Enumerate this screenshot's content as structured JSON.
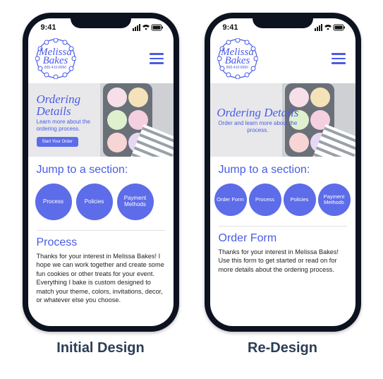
{
  "statusbar": {
    "time": "9:41"
  },
  "logo": {
    "line1": "Melissa",
    "line2": "Bakes",
    "phone": "865-410-8950"
  },
  "initial": {
    "caption": "Initial Design",
    "hero": {
      "title": "Ordering Details",
      "subtitle": "Learn more about the ordering process.",
      "button": "Start Your Order"
    },
    "jump_title": "Jump to a section:",
    "chips": [
      "Process",
      "Policies",
      "Payment Methods"
    ],
    "section": {
      "title": "Process",
      "body": "Thanks for your interest in Melissa Bakes! I hope we can work together and create some fun cookies or other treats for your event. Everything I bake is custom designed to match your theme, colors, invitations, decor, or whatever else you choose."
    }
  },
  "redesign": {
    "caption": "Re-Design",
    "hero": {
      "title": "Ordering Details",
      "subtitle": "Order and learn more about the  process."
    },
    "jump_title": "Jump to a section:",
    "chips": [
      "Order Form",
      "Process",
      "Policies",
      "Payment Methods"
    ],
    "section": {
      "title": "Order Form",
      "body": "Thanks for your interest in Melissa Bakes! Use this form to get started or read on for more details about the ordering process."
    }
  },
  "colors": {
    "accent": "#5d6ce8",
    "text_accent": "#4a5be6",
    "caption": "#2b3e55"
  }
}
